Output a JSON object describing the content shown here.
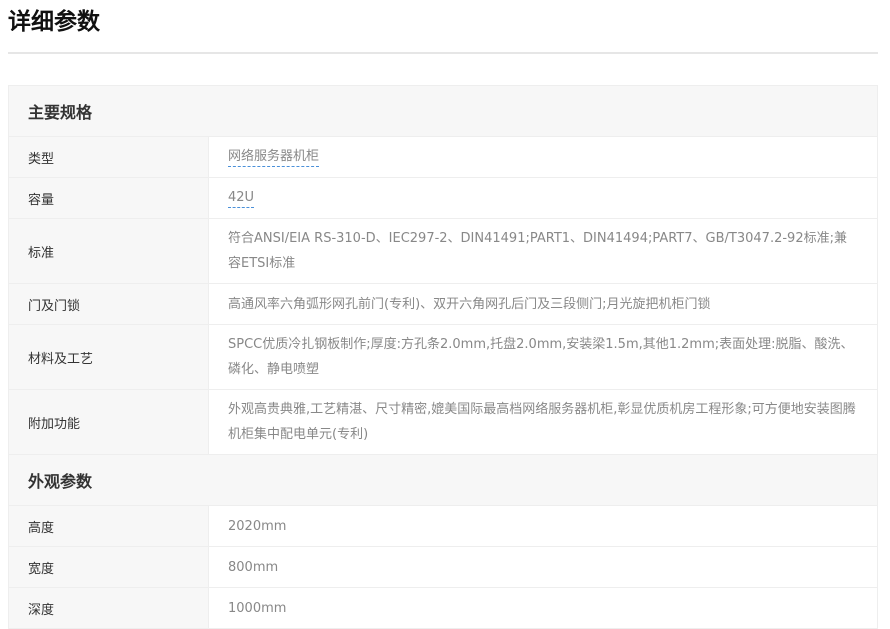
{
  "page": {
    "title": "详细参数"
  },
  "sections": [
    {
      "heading": "主要规格",
      "rows": [
        {
          "label": "类型",
          "value": "网络服务器机柜"
        },
        {
          "label": "容量",
          "value": "42U"
        },
        {
          "label": "标准",
          "value": "符合ANSI/EIA RS-310-D、IEC297-2、DIN41491;PART1、DIN41494;PART7、GB/T3047.2-92标准;兼容ETSI标准"
        },
        {
          "label": "门及门锁",
          "value": "高通风率六角弧形网孔前门(专利)、双开六角网孔后门及三段侧门;月光旋把机柜门锁"
        },
        {
          "label": "材料及工艺",
          "value": "SPCC优质冷扎钢板制作;厚度:方孔条2.0mm,托盘2.0mm,安装梁1.5m,其他1.2mm;表面处理:脱脂、酸洗、磷化、静电喷塑"
        },
        {
          "label": "附加功能",
          "value": "外观高贵典雅,工艺精湛、尺寸精密,媲美国际最高档网络服务器机柜,彰显优质机房工程形象;可方便地安装图腾机柜集中配电单元(专利)"
        }
      ]
    },
    {
      "heading": "外观参数",
      "rows": [
        {
          "label": "高度",
          "value": "2020mm"
        },
        {
          "label": "宽度",
          "value": "800mm"
        },
        {
          "label": "深度",
          "value": "1000mm"
        }
      ]
    }
  ],
  "colors": {
    "link_underline": "#4a90d9",
    "label_background": "#f7f7f7",
    "value_text": "#888888",
    "border": "#eeeeee"
  }
}
